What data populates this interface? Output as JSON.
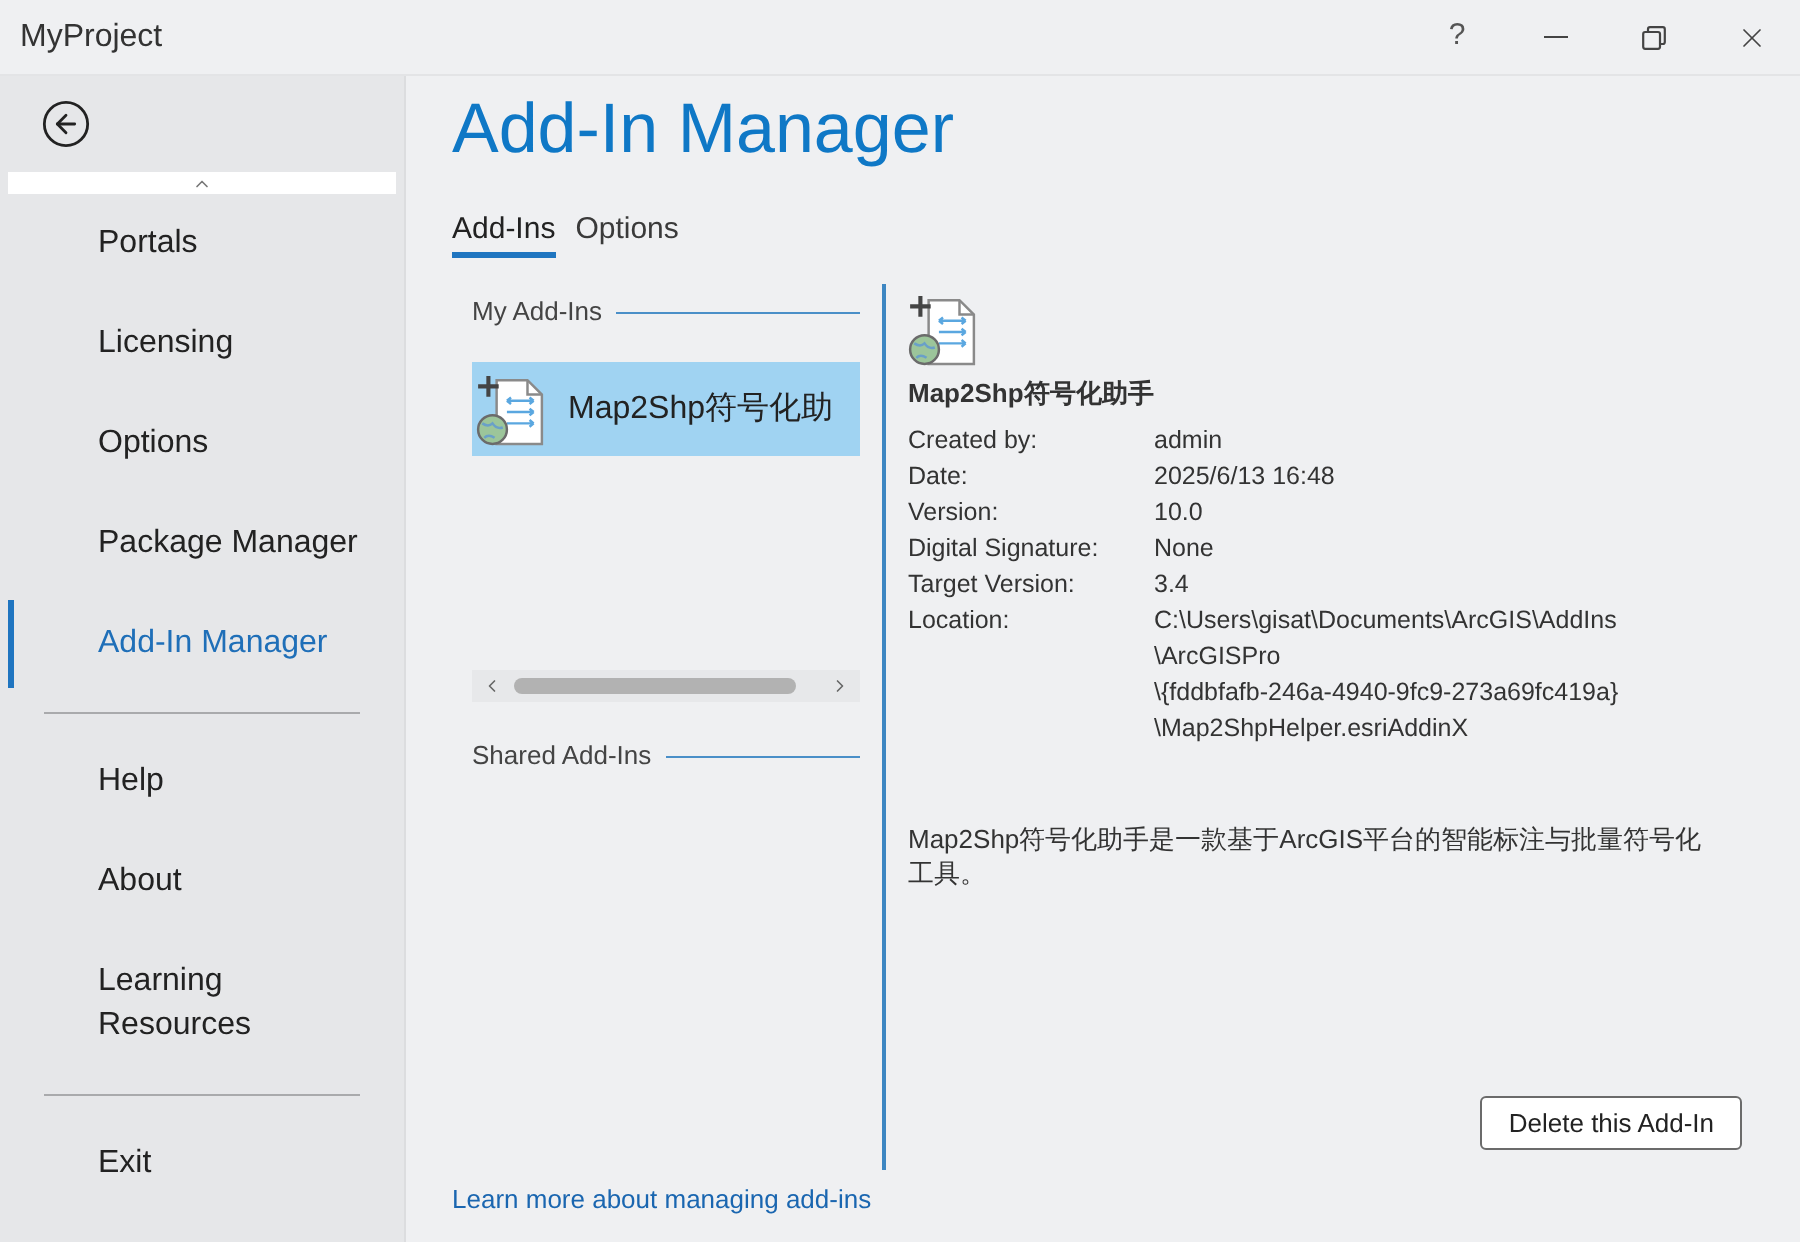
{
  "window": {
    "title": "MyProject",
    "help": "?"
  },
  "sidebar": {
    "sections": [
      {
        "items": [
          {
            "label": "Portals",
            "selected": false
          },
          {
            "label": "Licensing",
            "selected": false
          },
          {
            "label": "Options",
            "selected": false
          },
          {
            "label": "Package Manager",
            "selected": false
          },
          {
            "label": "Add-In Manager",
            "selected": true
          }
        ]
      },
      {
        "items": [
          {
            "label": "Help",
            "selected": false
          },
          {
            "label": "About",
            "selected": false
          },
          {
            "label": "Learning Resources",
            "selected": false
          }
        ]
      },
      {
        "items": [
          {
            "label": "Exit",
            "selected": false
          }
        ]
      }
    ]
  },
  "page": {
    "title": "Add-In Manager",
    "tabs": [
      {
        "label": "Add-Ins",
        "selected": true
      },
      {
        "label": "Options",
        "selected": false
      }
    ]
  },
  "my_addins": {
    "heading": "My Add-Ins",
    "items": [
      {
        "name": "Map2Shp符号化助",
        "selected": true
      }
    ]
  },
  "shared_addins": {
    "heading": "Shared Add-Ins"
  },
  "details": {
    "name": "Map2Shp符号化助手",
    "fields": [
      {
        "label": "Created by:",
        "lines": [
          "admin"
        ]
      },
      {
        "label": "Date:",
        "lines": [
          "2025/6/13 16:48"
        ]
      },
      {
        "label": "Version:",
        "lines": [
          "10.0"
        ]
      },
      {
        "label": "Digital Signature:",
        "lines": [
          "None"
        ]
      },
      {
        "label": "Target Version:",
        "lines": [
          "3.4"
        ]
      },
      {
        "label": "Location:",
        "lines": [
          "C:\\Users\\gisat\\Documents\\ArcGIS\\AddIns",
          "\\ArcGISPro",
          "\\{fddbfafb-246a-4940-9fc9-273a69fc419a}",
          "\\Map2ShpHelper.esriAddinX"
        ]
      }
    ],
    "description": "Map2Shp符号化助手是一款基于ArcGIS平台的智能标注与批量符号化工具。",
    "delete_button": "Delete this Add-In"
  },
  "learn_more_link": "Learn more about managing add-ins"
}
